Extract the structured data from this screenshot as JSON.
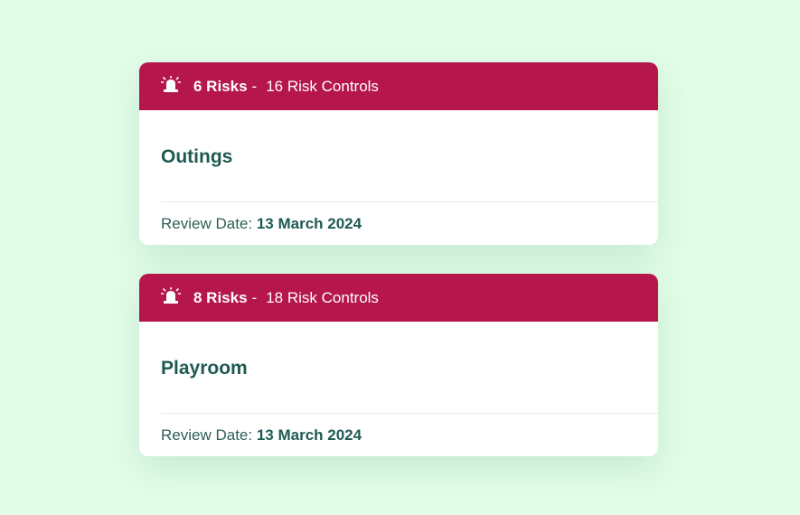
{
  "colors": {
    "background": "#e2fde9",
    "header": "#b5164c",
    "title": "#1e5a52"
  },
  "cards": [
    {
      "icon": "alarm-siren-icon",
      "risks": "6 Risks",
      "separator": "-",
      "controls": "16 Risk Controls",
      "title": "Outings",
      "review_label": "Review Date:",
      "review_date": "13 March 2024"
    },
    {
      "icon": "alarm-siren-icon",
      "risks": "8 Risks",
      "separator": "-",
      "controls": "18 Risk Controls",
      "title": "Playroom",
      "review_label": "Review Date:",
      "review_date": "13 March 2024"
    }
  ]
}
